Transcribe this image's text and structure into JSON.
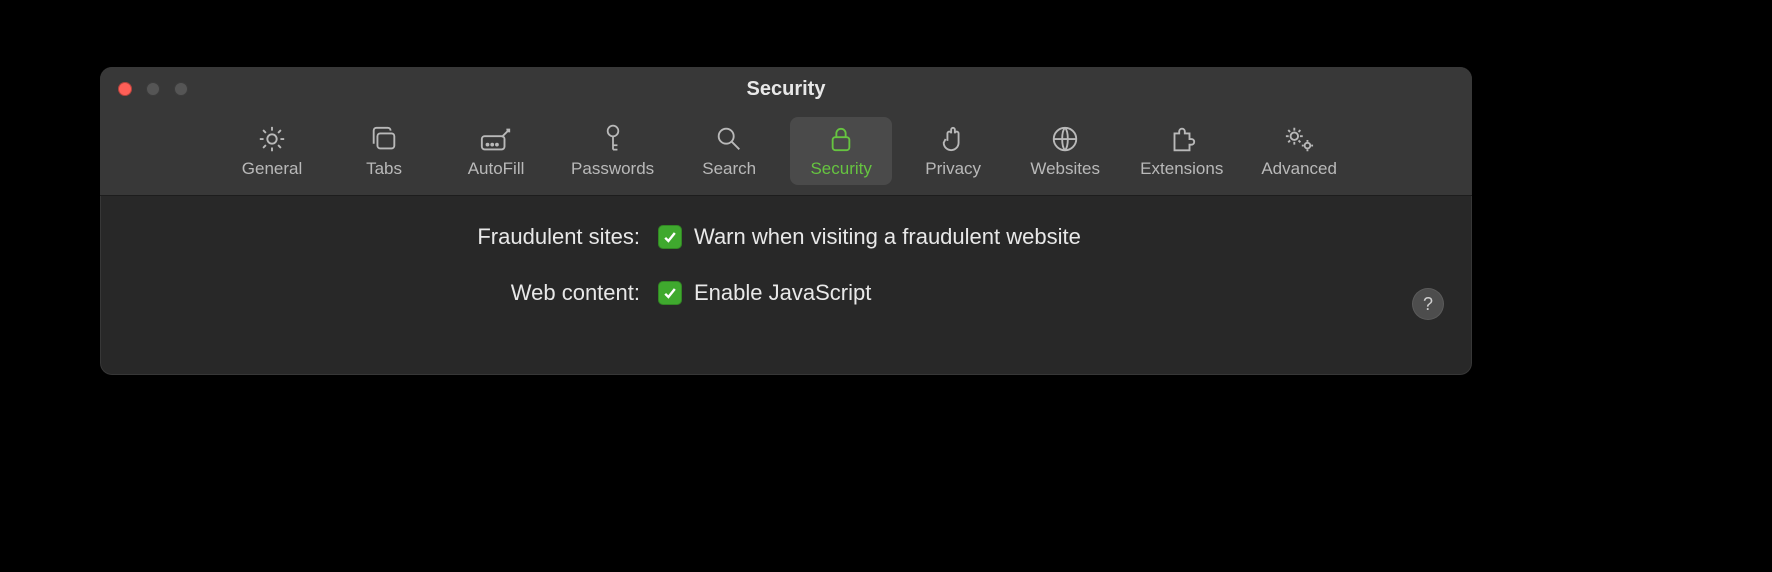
{
  "window": {
    "title": "Security"
  },
  "traffic": {
    "close_color": "#ff5f57",
    "min_color": "#555555",
    "max_color": "#555555"
  },
  "tabs": [
    {
      "label": "General",
      "active": false
    },
    {
      "label": "Tabs",
      "active": false
    },
    {
      "label": "AutoFill",
      "active": false
    },
    {
      "label": "Passwords",
      "active": false
    },
    {
      "label": "Search",
      "active": false
    },
    {
      "label": "Security",
      "active": true
    },
    {
      "label": "Privacy",
      "active": false
    },
    {
      "label": "Websites",
      "active": false
    },
    {
      "label": "Extensions",
      "active": false
    },
    {
      "label": "Advanced",
      "active": false
    }
  ],
  "settings": {
    "fraudulent": {
      "group_label": "Fraudulent sites:",
      "checkbox_label": "Warn when visiting a fraudulent website",
      "checked": true
    },
    "webcontent": {
      "group_label": "Web content:",
      "checkbox_label": "Enable JavaScript",
      "checked": true
    }
  },
  "help": {
    "label": "?"
  }
}
